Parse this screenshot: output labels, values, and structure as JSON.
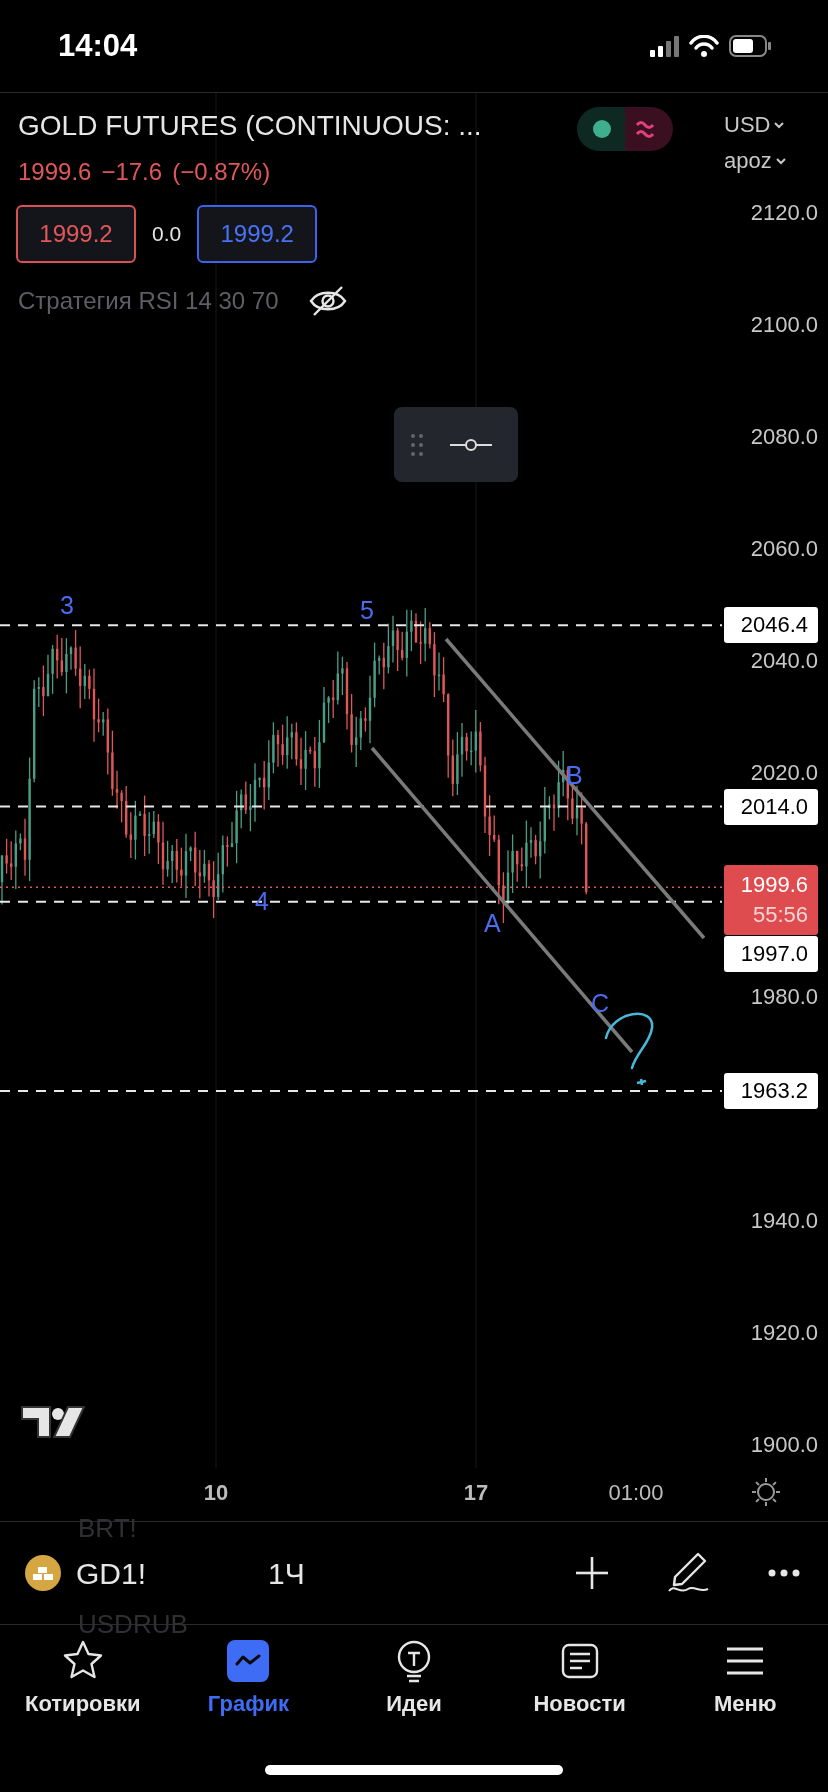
{
  "status_bar": {
    "time": "14:04"
  },
  "header": {
    "symbol_title": "GOLD FUTURES (CONTINUOUS: ...",
    "last_price": "1999.6",
    "change": "−17.6",
    "change_percent": "(−0.87%)",
    "sell_price": "1999.2",
    "spread": "0.0",
    "buy_price": "1999.2",
    "indicator": {
      "label": "Стратегия RSI 14 30 70",
      "hidden": true
    },
    "currency": "USD",
    "scale_mode": "apoz"
  },
  "price_axis": [
    "2120.0",
    "2100.0",
    "2080.0",
    "2060.0",
    "2040.0",
    "2020.0",
    "1980.0",
    "1940.0",
    "1920.0",
    "1900.0"
  ],
  "levels": [
    {
      "label": "2046.4"
    },
    {
      "label": "2014.0"
    },
    {
      "label": "1997.0"
    },
    {
      "label": "1963.2"
    }
  ],
  "current_price": {
    "price": "1999.6",
    "countdown": "55:56"
  },
  "wave_labels": [
    "3",
    "5",
    "4",
    "A",
    "B",
    "C"
  ],
  "time_axis": [
    {
      "label": "10",
      "bold": true
    },
    {
      "label": "17",
      "bold": true
    },
    {
      "label": "01:00",
      "bold": false
    }
  ],
  "toolbar": {
    "symbol": "GD1!",
    "interval": "1Ч",
    "background_symbols": [
      "BRT!",
      "USDRUB"
    ]
  },
  "tabs": [
    {
      "label": "Котировки",
      "selected": false
    },
    {
      "label": "График",
      "selected": true
    },
    {
      "label": "Идеи",
      "selected": false
    },
    {
      "label": "Новости",
      "selected": false
    },
    {
      "label": "Меню",
      "selected": false
    }
  ]
}
